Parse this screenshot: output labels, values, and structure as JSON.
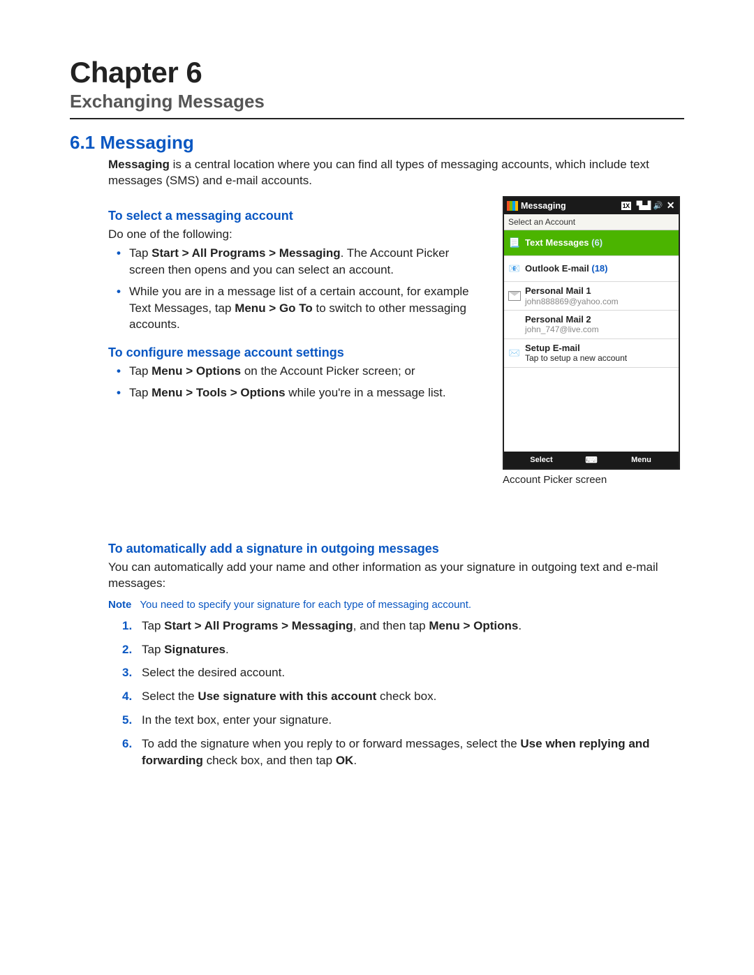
{
  "chapter": {
    "title": "Chapter 6",
    "subtitle": "Exchanging Messages"
  },
  "section": {
    "number_title": "6.1  Messaging",
    "intro_pre": "Messaging",
    "intro_post": " is a central location where you can find all types of messaging accounts, which include text messages (SMS) and e-mail accounts."
  },
  "sub1": {
    "heading": "To select a messaging account",
    "lead": "Do one of the following:",
    "b1_pre": "Tap ",
    "b1_bold": "Start > All Programs > Messaging",
    "b1_post": ". The Account Picker screen then opens and you can select an account.",
    "b2_pre": "While you are in a message list of a certain account, for example Text Messages, tap ",
    "b2_bold": "Menu > Go To",
    "b2_post": " to switch to other messaging accounts."
  },
  "sub2": {
    "heading": "To configure message account settings",
    "b1_pre": "Tap ",
    "b1_bold": "Menu > Options",
    "b1_post": " on the Account Picker screen; or",
    "b2_pre": "Tap ",
    "b2_bold": "Menu > Tools > Options",
    "b2_post": " while you're in a message list."
  },
  "device": {
    "top_title": "Messaging",
    "status_box": "1X",
    "select_label": "Select an Account",
    "acct1_name": "Text Messages",
    "acct1_count": "(6)",
    "acct2_name": "Outlook E-mail",
    "acct2_count": "(18)",
    "acct3_name": "Personal Mail 1",
    "acct3_sub": "john888869@yahoo.com",
    "acct4_name": "Personal Mail 2",
    "acct4_sub": "john_747@live.com",
    "acct5_name": "Setup E-mail",
    "acct5_sub": "Tap to setup a new account",
    "soft_left": "Select",
    "soft_right": "Menu",
    "caption": "Account Picker screen"
  },
  "sub3": {
    "heading": "To automatically add a signature in outgoing messages",
    "para": "You can automatically add your name and other information as your signature in outgoing text and e-mail messages:",
    "note_label": "Note",
    "note_text": "You need to specify your signature for each type of messaging account.",
    "s1_pre": "Tap ",
    "s1_bold1": "Start > All Programs > Messaging",
    "s1_mid": ", and then tap ",
    "s1_bold2": "Menu > Options",
    "s1_post": ".",
    "s2_pre": "Tap ",
    "s2_bold": "Signatures",
    "s2_post": ".",
    "s3": "Select the desired account.",
    "s4_pre": "Select the ",
    "s4_bold": "Use signature with this account",
    "s4_post": " check box.",
    "s5": "In the text box, enter your signature.",
    "s6_pre": "To add the signature when you reply to or forward messages, select the ",
    "s6_bold1": "Use when replying and forwarding",
    "s6_mid": " check box, and then tap ",
    "s6_bold2": "OK",
    "s6_post": "."
  }
}
